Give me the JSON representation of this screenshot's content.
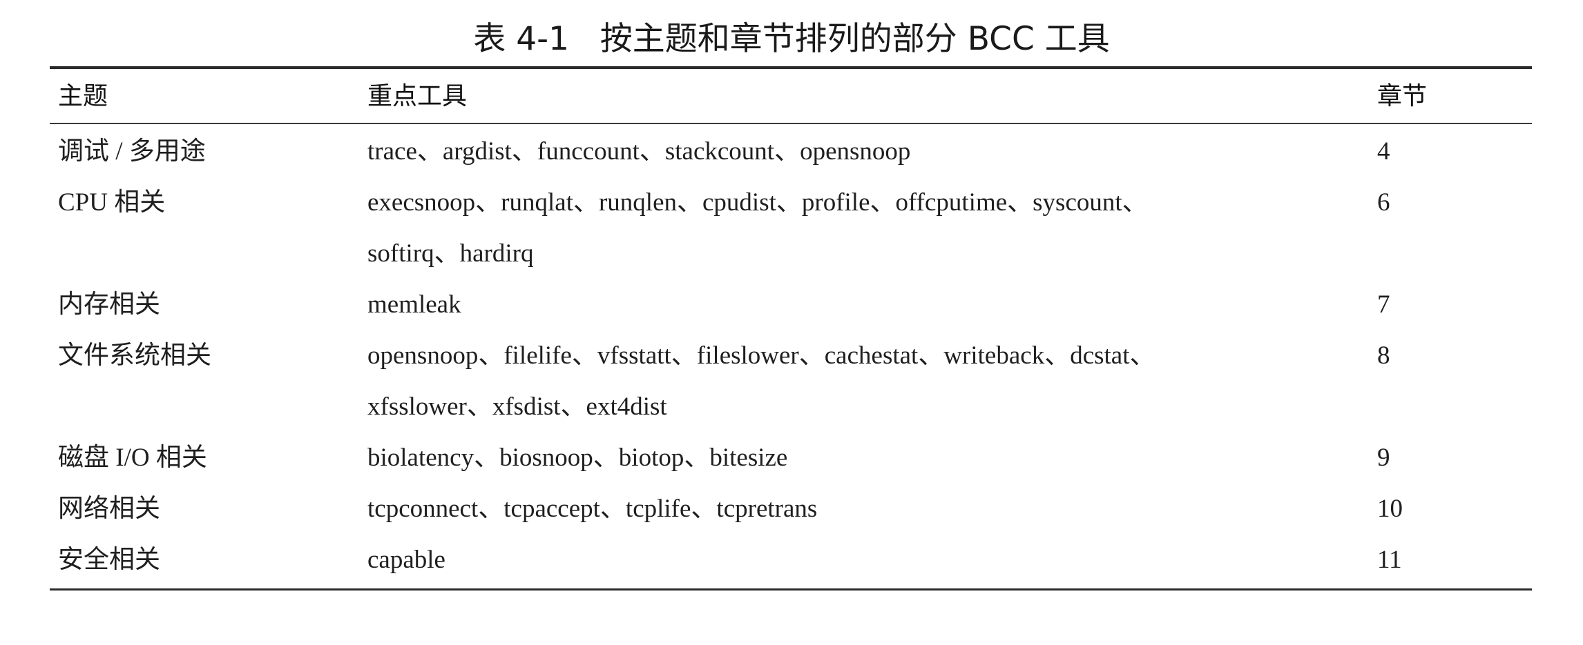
{
  "caption": "表 4-1   按主题和章节排列的部分 BCC 工具",
  "table": {
    "headers": {
      "topic": "主题",
      "tools": "重点工具",
      "chapter": "章节"
    },
    "rows": [
      {
        "topic": "调试 / 多用途",
        "tools": [
          "trace、argdist、funccount、stackcount、opensnoop"
        ],
        "chapter": "4"
      },
      {
        "topic": "CPU 相关",
        "tools": [
          "execsnoop、runqlat、runqlen、cpudist、profile、offcputime、syscount、",
          "softirq、hardirq"
        ],
        "chapter": "6"
      },
      {
        "topic": "内存相关",
        "tools": [
          "memleak"
        ],
        "chapter": "7"
      },
      {
        "topic": "文件系统相关",
        "tools": [
          "opensnoop、filelife、vfsstatt、fileslower、cachestat、writeback、dcstat、",
          "xfsslower、xfsdist、ext4dist"
        ],
        "chapter": "8"
      },
      {
        "topic": "磁盘 I/O 相关",
        "tools": [
          "biolatency、biosnoop、biotop、bitesize"
        ],
        "chapter": "9"
      },
      {
        "topic": "网络相关",
        "tools": [
          "tcpconnect、tcpaccept、tcplife、tcpretrans"
        ],
        "chapter": "10"
      },
      {
        "topic": "安全相关",
        "tools": [
          "capable"
        ],
        "chapter": "11"
      }
    ]
  }
}
